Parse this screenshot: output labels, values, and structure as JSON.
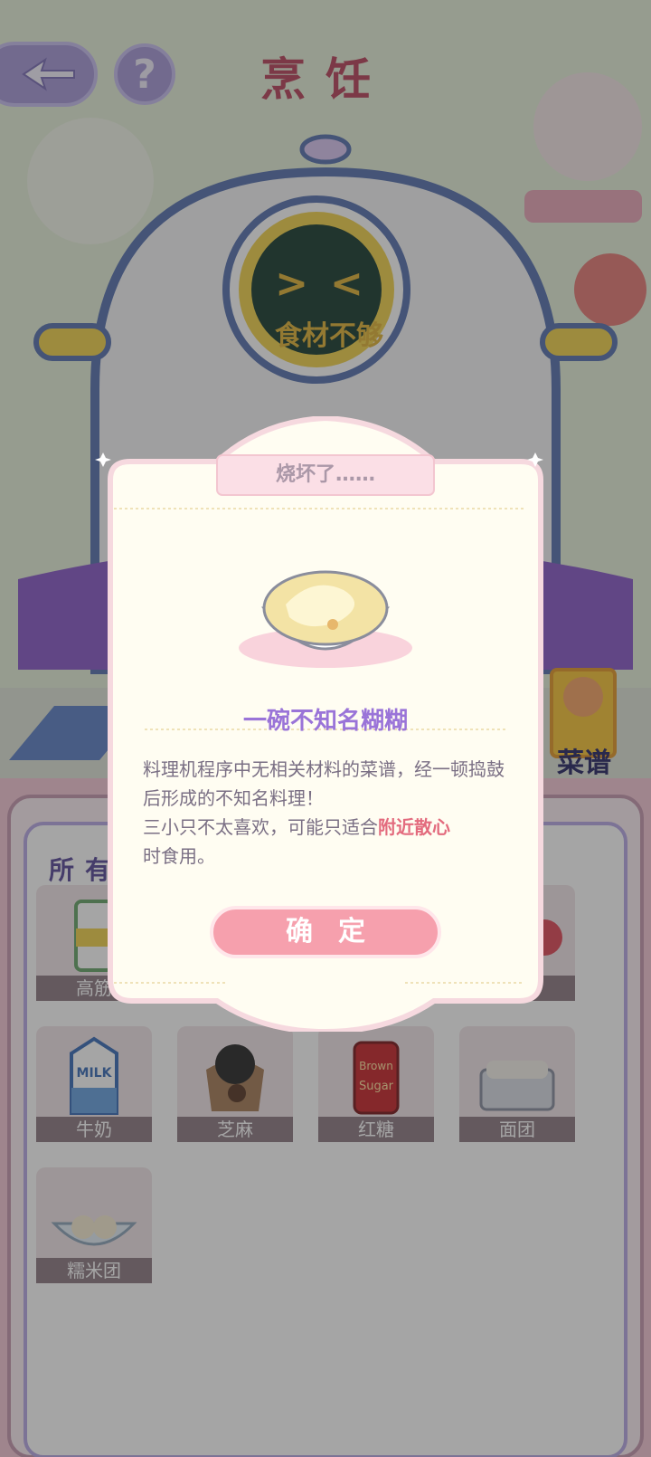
{
  "header": {
    "title": "烹饪",
    "back_icon": "back-arrow-icon",
    "help_label": "?"
  },
  "machine": {
    "face": "><",
    "screen_text": "食材不够"
  },
  "recipe_book": {
    "label": "菜谱"
  },
  "inventory": {
    "title": "所有",
    "items": [
      {
        "label": "高筋",
        "icon": "flour-icon"
      },
      {
        "label": "",
        "icon": "strawberry-icon"
      },
      {
        "label": "牛奶",
        "icon": "milk-icon"
      },
      {
        "label": "芝麻",
        "icon": "sesame-icon"
      },
      {
        "label": "红糖",
        "icon": "brown-sugar-icon"
      },
      {
        "label": "面团",
        "icon": "dough-icon"
      },
      {
        "label": "糯米团",
        "icon": "rice-ball-icon"
      }
    ]
  },
  "modal": {
    "tab_title": "烧坏了……",
    "dish_name": "一碗不知名糊糊",
    "description_part1": "料理机程序中无相关材料的菜谱，经一顿捣鼓后形成的不知名料理！",
    "description_part2": "三小只不太喜欢，可能只适合",
    "description_highlight": "附近散心",
    "description_part3": "时食用。",
    "confirm_label": "确定"
  },
  "colors": {
    "accent_pink": "#f6a0ad",
    "title_red": "#b9465e",
    "purple": "#9a74d8"
  }
}
